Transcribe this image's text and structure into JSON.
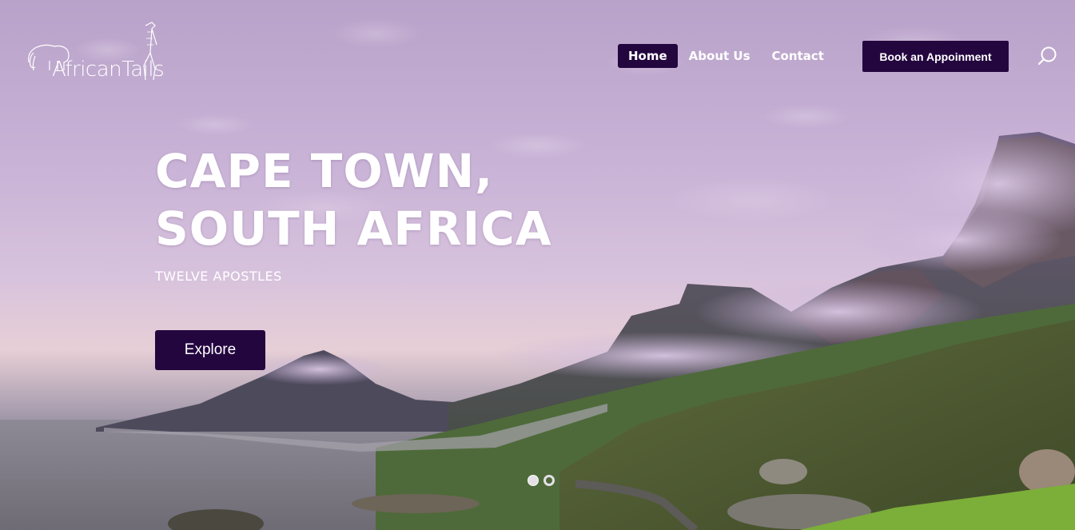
{
  "brand": {
    "logo_text": "AfricanTails"
  },
  "nav": {
    "items": [
      {
        "label": "Home",
        "active": true
      },
      {
        "label": "About Us",
        "active": false
      },
      {
        "label": "Contact",
        "active": false
      }
    ],
    "cta_label": "Book an Appoinment",
    "search_icon": "search-icon"
  },
  "hero": {
    "title_line1": "CAPE TOWN,",
    "title_line2": "SOUTH AFRICA",
    "subtitle": "TWELVE APOSTLES",
    "button_label": "Explore"
  },
  "slider": {
    "dots": [
      {
        "active": true
      },
      {
        "active": false
      }
    ]
  },
  "colors": {
    "accent": "#24063f",
    "text": "#ffffff",
    "sky": "#c8b2d6"
  }
}
